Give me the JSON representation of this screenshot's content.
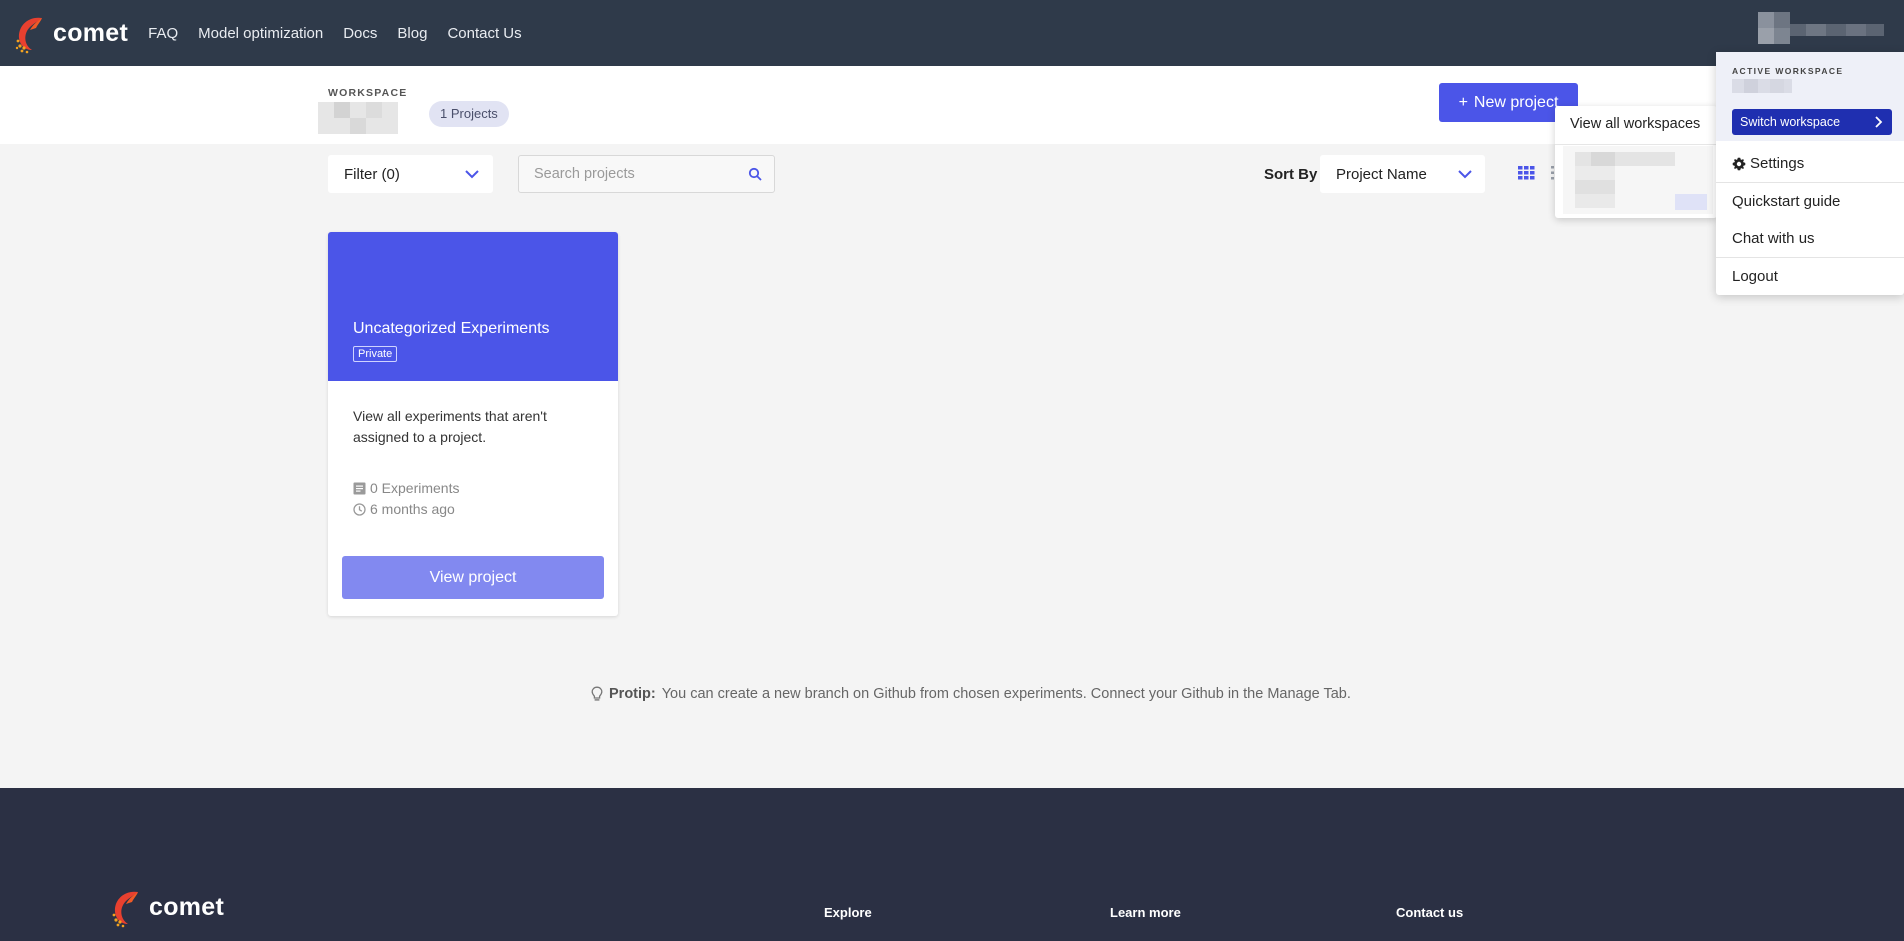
{
  "nav": {
    "brand": "comet",
    "links": [
      "FAQ",
      "Model optimization",
      "Docs",
      "Blog",
      "Contact Us"
    ]
  },
  "workspace": {
    "label": "WORKSPACE",
    "projects_count": "1 Projects",
    "new_project": "New project"
  },
  "controls": {
    "filter": "Filter (0)",
    "search_placeholder": "Search projects",
    "sort_by_label": "Sort By",
    "sort_value": "Project Name"
  },
  "card": {
    "title": "Uncategorized Experiments",
    "badge": "Private",
    "description": "View all experiments that aren't assigned to a project.",
    "experiments": "0 Experiments",
    "updated": "6 months ago",
    "view_button": "View project"
  },
  "protip": {
    "label": "Protip:",
    "text": "You can create a new branch on Github from chosen experiments. Connect your Github in the Manage Tab."
  },
  "footer": {
    "brand": "comet",
    "columns": [
      "Explore",
      "Learn more",
      "Contact us"
    ]
  },
  "workspace_submenu": {
    "view_all": "View all workspaces"
  },
  "account_menu": {
    "label": "ACTIVE WORKSPACE",
    "switch": "Switch workspace",
    "items": [
      "Settings",
      "Quickstart guide",
      "Chat with us",
      "Logout"
    ]
  },
  "colors": {
    "nav_bg": "#2f3a4a",
    "accent": "#4b55e8",
    "footer_bg": "#2b3044"
  }
}
